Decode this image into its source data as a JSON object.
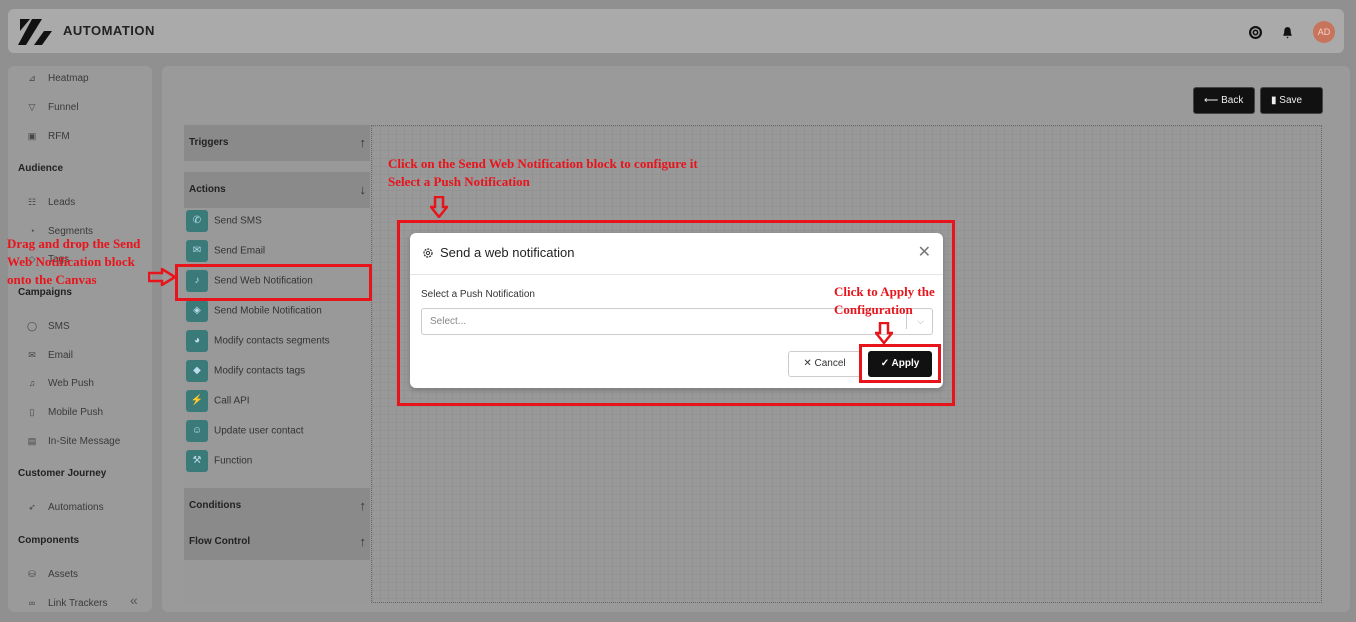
{
  "header": {
    "title": "AUTOMATION",
    "avatar": "AD"
  },
  "sidebar": {
    "items_top": [
      {
        "icon": "heatmap-icon",
        "label": "Heatmap"
      },
      {
        "icon": "funnel-icon",
        "label": "Funnel"
      },
      {
        "icon": "rfm-icon",
        "label": "RFM"
      }
    ],
    "audience": {
      "title": "Audience",
      "items": [
        {
          "label": "Leads"
        },
        {
          "label": "Segments"
        },
        {
          "label": "Tags"
        }
      ]
    },
    "campaigns": {
      "title": "Campaigns",
      "items": [
        {
          "label": "SMS"
        },
        {
          "label": "Email"
        },
        {
          "label": "Web Push"
        },
        {
          "label": "Mobile Push"
        },
        {
          "label": "In-Site Message"
        }
      ]
    },
    "journey": {
      "title": "Customer Journey",
      "items": [
        {
          "label": "Automations"
        }
      ]
    },
    "components": {
      "title": "Components",
      "items": [
        {
          "label": "Assets"
        },
        {
          "label": "Link Trackers"
        }
      ]
    }
  },
  "toolbar": {
    "back": "Back",
    "save": "Save"
  },
  "palette": {
    "triggers": "Triggers",
    "actions": "Actions",
    "conditions": "Conditions",
    "flow": "Flow Control",
    "action_items": [
      "Send SMS",
      "Send Email",
      "Send Web Notification",
      "Send Mobile Notification",
      "Modify contacts segments",
      "Modify contacts tags",
      "Call API",
      "Update user contact",
      "Function"
    ]
  },
  "annotations": {
    "drag": [
      "Drag and drop the Send",
      "Web Notification block",
      "onto the Canvas"
    ],
    "click_block": [
      "Click on the Send Web Notification block to configure it",
      "Select a Push Notification"
    ],
    "apply": [
      "Click to Apply the",
      "Configuration"
    ]
  },
  "modal": {
    "title": "Send a web notification",
    "field_label": "Select a Push Notification",
    "placeholder": "Select...",
    "cancel": "Cancel",
    "apply": "Apply"
  },
  "colors": {
    "annotation": "#e8141c",
    "accent": "#3a7b7a"
  }
}
